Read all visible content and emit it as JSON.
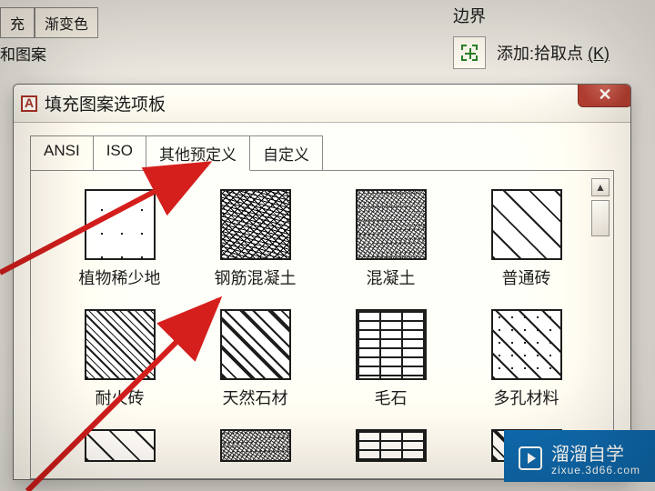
{
  "background": {
    "tab_fill": "充",
    "tab_gradient": "渐变色",
    "section_fill_pattern": "和图案",
    "boundary_label": "边界",
    "add_pick_label": "添加:拾取点",
    "add_pick_hotkey": "(K)"
  },
  "dialog": {
    "title": "填充图案选项板",
    "tabs": [
      "ANSI",
      "ISO",
      "其他预定义",
      "自定义"
    ],
    "active_tab_index": 2,
    "patterns_row1": [
      {
        "label": "植物稀少地",
        "swatch": "sw-sparse"
      },
      {
        "label": "钢筋混凝土",
        "swatch": "sw-noise1"
      },
      {
        "label": "混凝土",
        "swatch": "sw-noise2"
      },
      {
        "label": "普通砖",
        "swatch": "sw-diag45"
      }
    ],
    "patterns_row2": [
      {
        "label": "耐火砖",
        "swatch": "sw-diag45d"
      },
      {
        "label": "天然石材",
        "swatch": "sw-diag45dash"
      },
      {
        "label": "毛石",
        "swatch": "sw-brick"
      },
      {
        "label": "多孔材料",
        "swatch": "sw-diag-dots"
      }
    ]
  },
  "watermark": {
    "brand": "溜溜自学",
    "url": "zixue.3d66.com"
  }
}
